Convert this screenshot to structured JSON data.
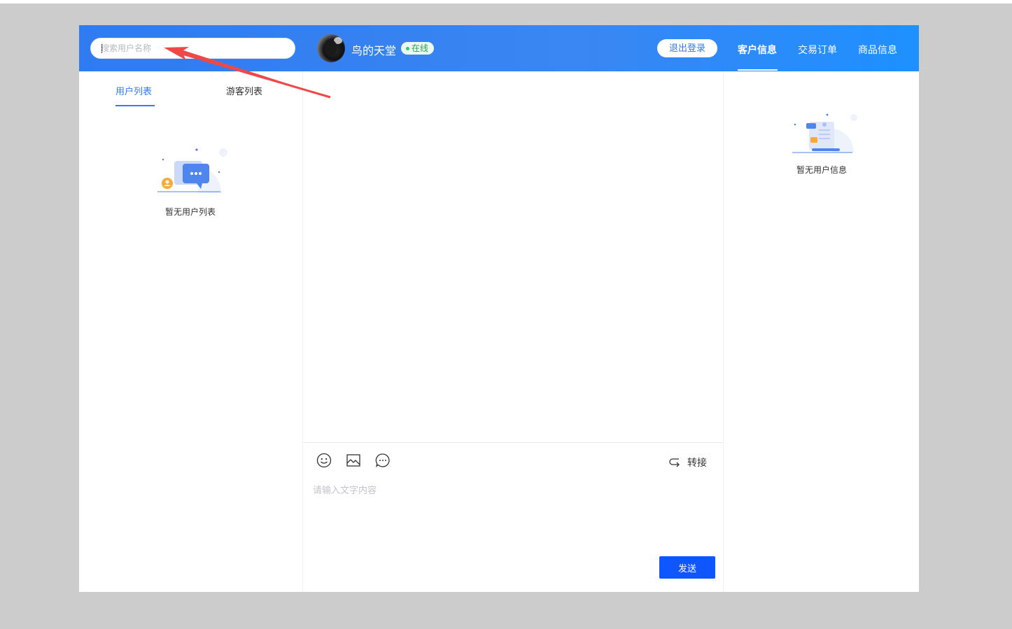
{
  "search": {
    "placeholder": "搜索用户名称"
  },
  "header": {
    "shop_name": "鸟的天堂",
    "status": "在线",
    "logout_label": "退出登录",
    "tabs": [
      {
        "label": "客户信息",
        "active": true
      },
      {
        "label": "交易订单",
        "active": false
      },
      {
        "label": "商品信息",
        "active": false
      }
    ]
  },
  "left": {
    "tabs": [
      {
        "label": "用户列表",
        "active": true
      },
      {
        "label": "游客列表",
        "active": false
      }
    ],
    "empty_text": "暂无用户列表"
  },
  "composer": {
    "tools": [
      "emoji-icon",
      "image-icon",
      "quick-reply-icon"
    ],
    "transfer_label": "转接",
    "input_placeholder": "请输入文字内容",
    "send_label": "发送"
  },
  "right": {
    "empty_text": "暂无用户信息"
  },
  "colors": {
    "header_gradient_start": "#2f7bf0",
    "header_gradient_end": "#1e90ff",
    "accent": "#2f7bf0",
    "send_button": "#1056ff",
    "online_dot": "#34c76b",
    "annotation_arrow": "#f04848"
  }
}
